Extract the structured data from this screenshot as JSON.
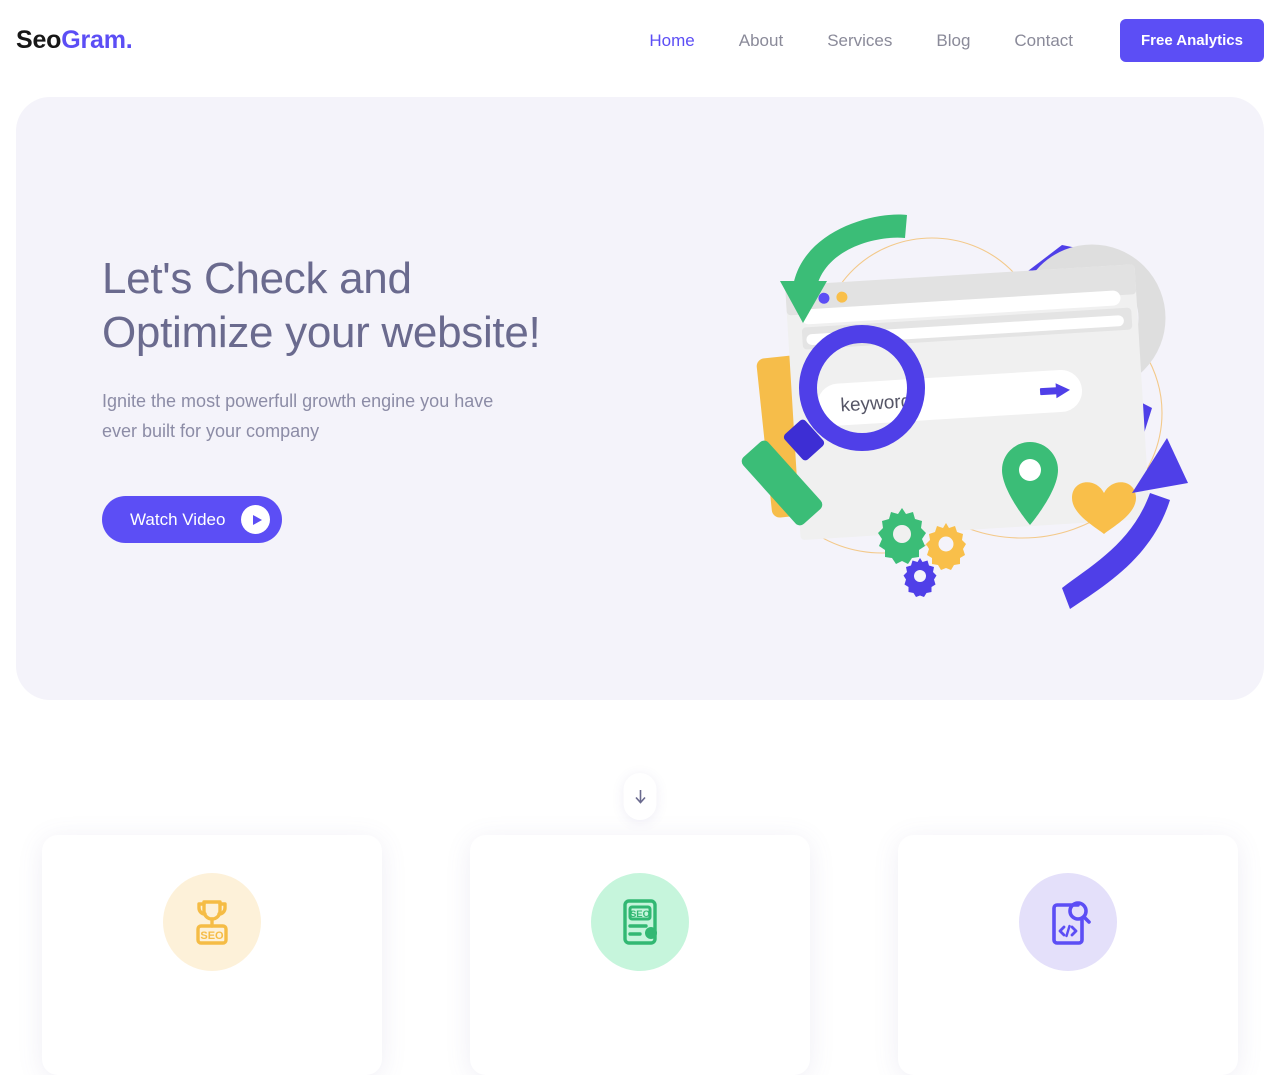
{
  "brand": {
    "name_part1": "Seo",
    "name_part2": "Gram.",
    "accent_color": "#5c4ef5",
    "logo_dark_color": "#171717"
  },
  "nav": {
    "items": [
      {
        "label": "Home",
        "active": true
      },
      {
        "label": "About",
        "active": false
      },
      {
        "label": "Services",
        "active": false
      },
      {
        "label": "Blog",
        "active": false
      },
      {
        "label": "Contact",
        "active": false
      }
    ],
    "cta_label": "Free Analytics"
  },
  "hero": {
    "title": "Let's Check and\nOptimize your website!",
    "subtitle": "Ignite the most powerfull growth engine you have\never built for your company",
    "button_label": "Watch Video",
    "button_icon": "play-icon",
    "background_color": "#f4f3fa",
    "illustration": {
      "browser_search_value": "keyword",
      "browser_dots": [
        "#3bbd77",
        "#5c4ef5",
        "#f9bf4a"
      ],
      "donut_segments": [
        {
          "color": "#f9bf4a",
          "label": "yellow"
        },
        {
          "color": "#3bbd77",
          "label": "green"
        },
        {
          "color": "#dedede",
          "label": "grey"
        }
      ],
      "icons": [
        "magnifier-icon",
        "gear-green-icon",
        "gear-yellow-icon",
        "gear-purple-icon",
        "location-pin-icon",
        "heart-icon",
        "arrow-green-down-icon",
        "arrow-purple-up-icon",
        "send-arrow-icon"
      ]
    }
  },
  "scroll_down": {
    "icon": "arrow-down-icon"
  },
  "features": {
    "cards": [
      {
        "icon": "trophy-seo-icon",
        "icon_color": "#f5bc45",
        "circle_color": "#fdf1d9"
      },
      {
        "icon": "seo-report-icon",
        "icon_color": "#32b873",
        "circle_color": "#c6f5dc"
      },
      {
        "icon": "code-audit-icon",
        "icon_color": "#5c4ef5",
        "circle_color": "#e4e0fa"
      }
    ]
  }
}
